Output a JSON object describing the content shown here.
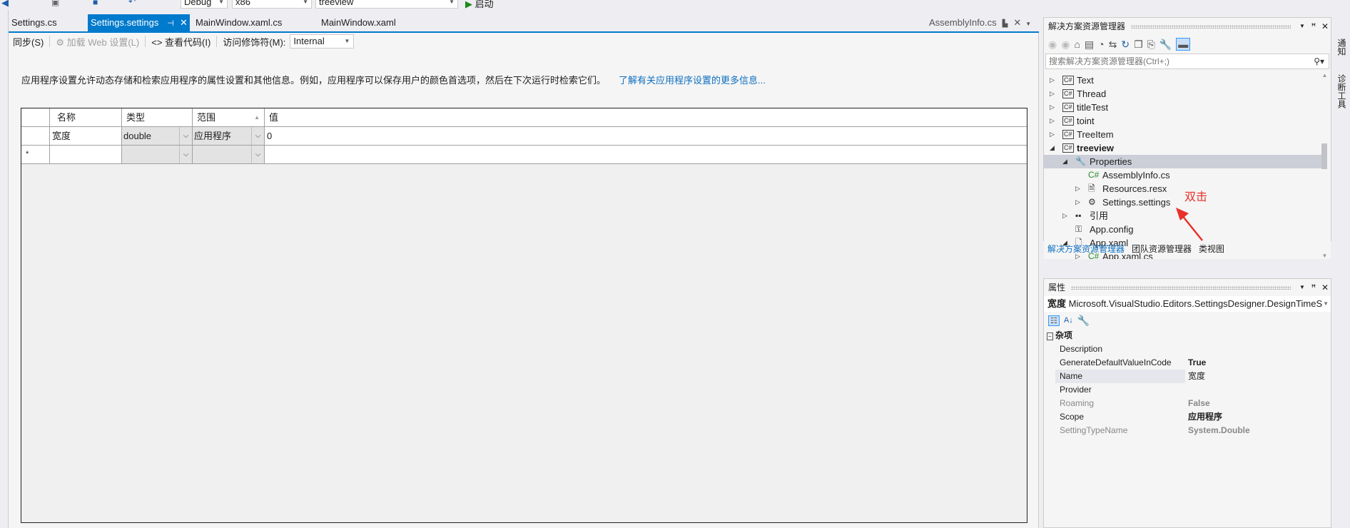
{
  "toolbar": {
    "config": "Debug",
    "platform": "x86",
    "project": "treeview",
    "start": "启动"
  },
  "tabs": [
    {
      "label": "Settings.cs"
    },
    {
      "label": "Settings.settings",
      "active": true
    },
    {
      "label": "MainWindow.xaml.cs"
    },
    {
      "label": "MainWindow.xaml"
    }
  ],
  "tabs_right": {
    "preview": "AssemblyInfo.cs"
  },
  "doc_toolbar": {
    "sync": "同步(S)",
    "load_web": "加载 Web 设置(L)",
    "view_code": "查看代码(I)",
    "access_label": "访问修饰符(M):",
    "access_value": "Internal"
  },
  "description": "应用程序设置允许动态存储和检索应用程序的属性设置和其他信息。例如，应用程序可以保存用户的颜色首选项，然后在下次运行时检索它们。",
  "learn_more": "了解有关应用程序设置的更多信息...",
  "grid": {
    "headers": [
      "名称",
      "类型",
      "范围",
      "值"
    ],
    "rows": [
      {
        "name": "宽度",
        "type": "double",
        "scope": "应用程序",
        "value": "0"
      }
    ],
    "new_row_marker": "*"
  },
  "solution_explorer": {
    "title": "解决方案资源管理器",
    "search_placeholder": "搜索解决方案资源管理器(Ctrl+;)",
    "items": [
      {
        "label": "Text",
        "icon": "csharp-project-icon",
        "state": "collapsed"
      },
      {
        "label": "Thread",
        "icon": "csharp-project-icon",
        "state": "collapsed"
      },
      {
        "label": "titleTest",
        "icon": "csharp-project-icon",
        "state": "collapsed"
      },
      {
        "label": "toint",
        "icon": "csharp-project-icon",
        "state": "collapsed"
      },
      {
        "label": "TreeItem",
        "icon": "csharp-project-icon",
        "state": "collapsed"
      },
      {
        "label": "treeview",
        "icon": "csharp-project-icon",
        "state": "expanded",
        "bold": true
      },
      {
        "label": "Properties",
        "icon": "wrench-icon",
        "state": "expanded",
        "selected": true
      },
      {
        "label": "AssemblyInfo.cs",
        "icon": "csharp-file-icon"
      },
      {
        "label": "Resources.resx",
        "icon": "resx-icon",
        "state": "collapsed"
      },
      {
        "label": "Settings.settings",
        "icon": "gear-icon",
        "state": "collapsed"
      },
      {
        "label": "引用",
        "icon": "references-icon",
        "state": "collapsed"
      },
      {
        "label": "App.config",
        "icon": "config-icon"
      },
      {
        "label": "App.xaml",
        "icon": "xaml-icon",
        "state": "expanded"
      },
      {
        "label": "App.xaml.cs",
        "icon": "csharp-file-icon",
        "state": "collapsed"
      }
    ],
    "bottom_tabs": [
      "解决方案资源管理器",
      "团队资源管理器",
      "类视图"
    ]
  },
  "annotation": {
    "text": "双击",
    "color": "#e8312a"
  },
  "properties": {
    "title": "属性",
    "object_name": "宽度",
    "object_type": "Microsoft.VisualStudio.Editors.SettingsDesigner.DesignTimeS",
    "category": "杂项",
    "rows": [
      {
        "name": "Description",
        "value": ""
      },
      {
        "name": "GenerateDefaultValueInCode",
        "value": "True"
      },
      {
        "name": "Name",
        "value": "宽度"
      },
      {
        "name": "Provider",
        "value": ""
      },
      {
        "name": "Roaming",
        "value": "False",
        "readonly": true
      },
      {
        "name": "Scope",
        "value": "应用程序"
      },
      {
        "name": "SettingTypeName",
        "value": "System.Double",
        "readonly": true
      }
    ]
  },
  "right_strip": [
    "通知",
    "诊断工具"
  ],
  "colors": {
    "accent": "#007acc",
    "selected": "#ccced8"
  }
}
